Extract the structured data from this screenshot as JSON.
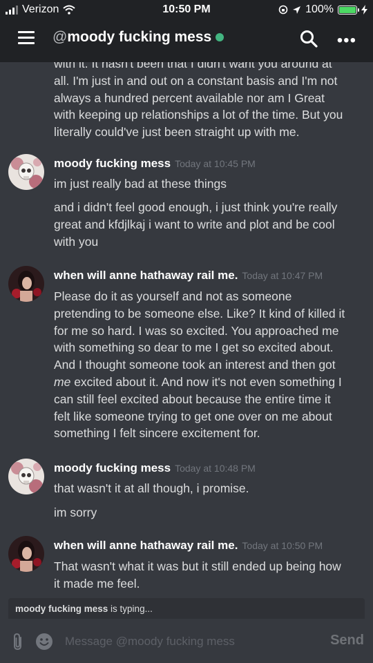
{
  "status_bar": {
    "carrier": "Verizon",
    "time": "10:50 PM",
    "battery": "100%"
  },
  "header": {
    "at": "@",
    "channel_name": "moody fucking mess"
  },
  "messages": {
    "m0": {
      "lines": [
        "with it. It hasn't been that I didn't want you around at",
        "all. I'm just in and out on a constant basis and I'm not",
        "always a hundred percent available nor am I Great",
        "with keeping up relationships a lot of the time. But you",
        "literally could've just been straight up with me."
      ]
    },
    "m1": {
      "author": "moody fucking mess",
      "timestamp": "Today at 10:45 PM",
      "p1": [
        "im just really bad at these things"
      ],
      "p2": [
        "and i didn't feel good enough, i just think you're really",
        "great and kfdjlkaj i want to write and plot and be cool",
        "with you"
      ]
    },
    "m2": {
      "author": "when will anne hathaway rail me.",
      "timestamp": "Today at 10:47 PM",
      "lines": [
        "Please do it as yourself and not as someone",
        "pretending to be someone else. Like? It kind of killed it",
        "for me so hard. I was so excited. You approached me",
        "with something so dear to me I get so excited about.",
        "And I thought someone took an interest and then got",
        "excited about it. And now it's not even something I",
        "can still feel excited about because the entire time it",
        "felt like someone trying to get one over on me about",
        "something I felt sincere excitement for."
      ],
      "italic_word": "me"
    },
    "m3": {
      "author": "moody fucking mess",
      "timestamp": "Today at 10:48 PM",
      "p1": [
        "that wasn't it at all though, i promise."
      ],
      "p2": [
        "im sorry"
      ]
    },
    "m4": {
      "author": "when will anne hathaway rail me.",
      "timestamp": "Today at 10:50 PM",
      "lines": [
        "That wasn't what it was but it still ended up being how",
        "it made me feel."
      ]
    }
  },
  "typing": {
    "name": "moody fucking mess",
    "suffix": " is typing..."
  },
  "composer": {
    "placeholder": "Message @moody fucking mess",
    "send_label": "Send"
  },
  "colors": {
    "background": "#36393f",
    "header": "#202225",
    "online": "#43b581",
    "battery": "#4cd964"
  },
  "icons": [
    "wifi-icon",
    "location-icon",
    "rotation-lock-icon",
    "hamburger-icon",
    "search-icon",
    "more-icon",
    "attachment-icon",
    "emoji-icon"
  ]
}
